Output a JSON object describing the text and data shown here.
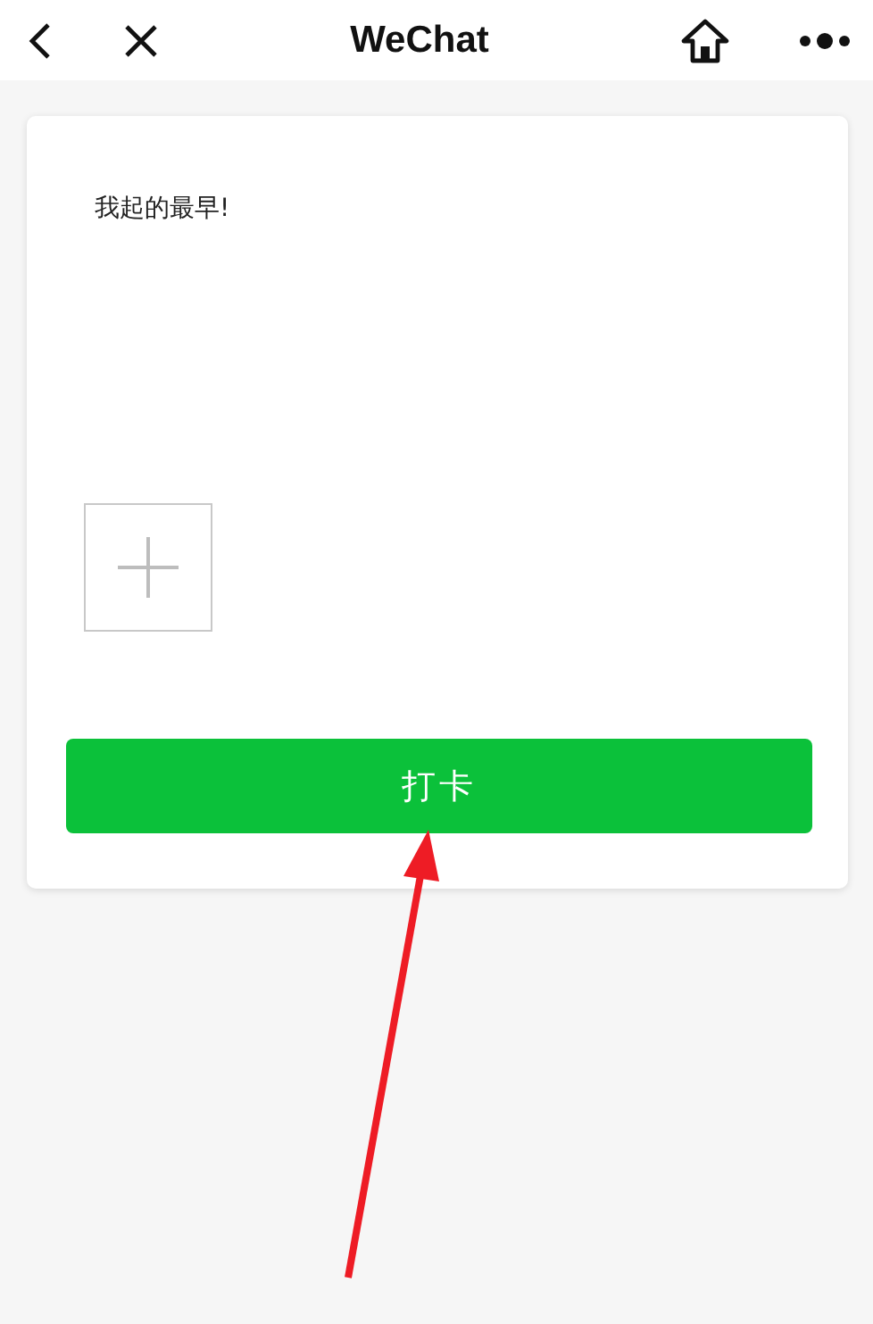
{
  "nav_bar": {
    "title": "WeChat"
  },
  "card": {
    "text": "我起的最早!",
    "button": "打卡"
  }
}
